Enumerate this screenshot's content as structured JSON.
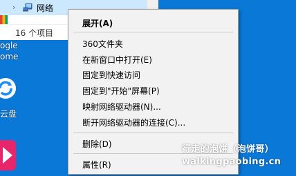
{
  "explorer": {
    "nav_item_label": "网络",
    "status_count": "16 个项目"
  },
  "desktop": {
    "chrome_label_1": "ogle",
    "chrome_label_2": "ome",
    "cloud_label": "云盘"
  },
  "context_menu": {
    "items": [
      {
        "label": "展开(A)",
        "bold": true
      },
      {
        "label": "360文件夹"
      },
      {
        "label": "在新窗口中打开(E)"
      },
      {
        "label": "固定到快速访问"
      },
      {
        "label": "固定到\"开始\"屏幕(P)"
      },
      {
        "label": "映射网络驱动器(N)..."
      },
      {
        "label": "断开网络驱动器的连接(C)..."
      },
      {
        "label": "删除(D)"
      },
      {
        "label": "属性(R)"
      }
    ]
  },
  "watermark": {
    "line1": "行走的泡饼（泡饼哥）",
    "line2": "walkingpaobing.cn"
  },
  "colors": {
    "desktop_bg": "#0a78d7",
    "menu_bg": "#f2f2f2",
    "selected_row": "#cce8ff"
  },
  "icons": [
    "chevron-right-icon",
    "network-icon",
    "chrome-icon",
    "cloud-sync-icon",
    "app-icon"
  ]
}
